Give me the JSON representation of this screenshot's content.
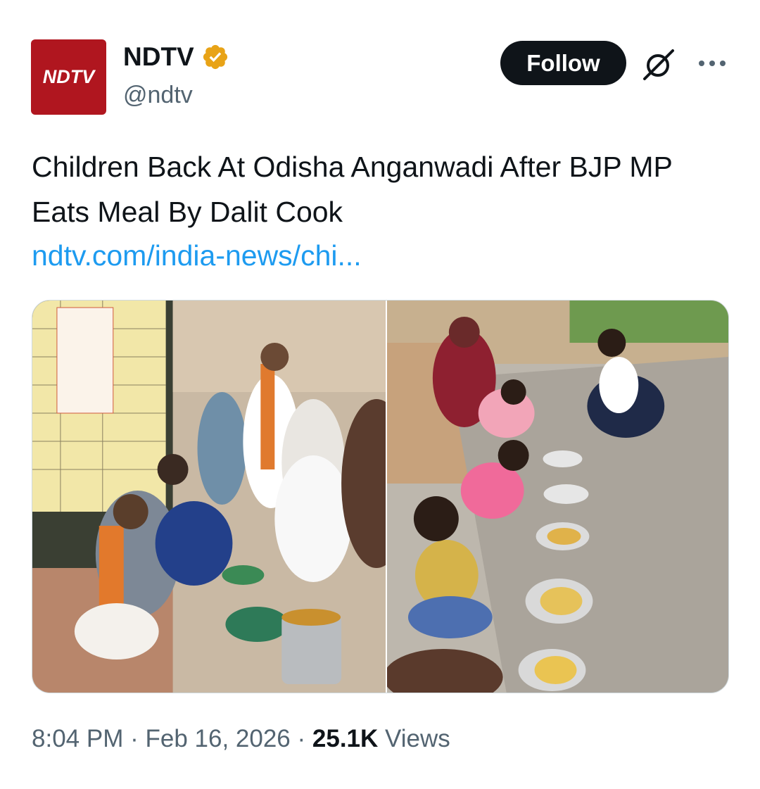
{
  "author": {
    "avatar_text": "NDTV",
    "display_name": "NDTV",
    "handle": "@ndtv",
    "verified_color": "#e8a317"
  },
  "actions": {
    "follow_label": "Follow"
  },
  "tweet": {
    "text": "Children Back At Odisha Anganwadi After BJP MP Eats Meal By Dalit Cook",
    "link": "ndtv.com/india-news/chi..."
  },
  "footer": {
    "time": "8:04 PM",
    "date": "Feb 16, 2026",
    "views_count": "25.1K",
    "views_label": "Views"
  },
  "icons": {
    "verified": "verified-badge-icon",
    "grok": "grok-icon",
    "more": "more-options-icon"
  },
  "colors": {
    "brand_red": "#b0161f",
    "text": "#0f1419",
    "secondary": "#536471",
    "link": "#1d9bf0"
  }
}
